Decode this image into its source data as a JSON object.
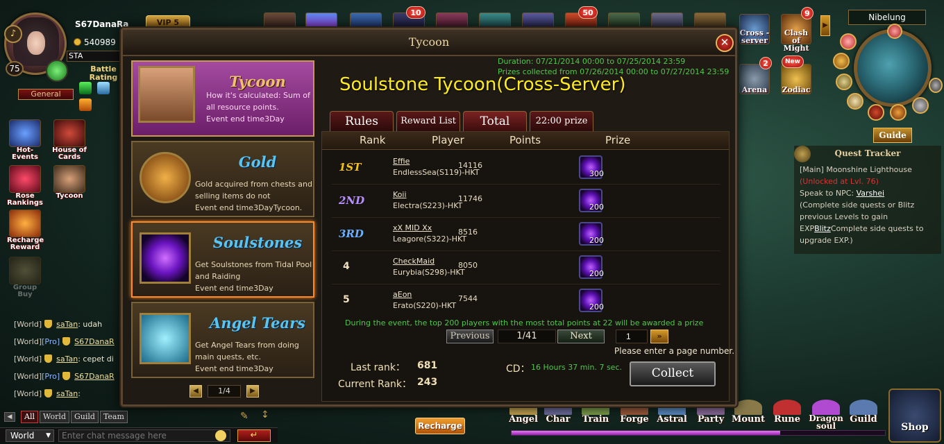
{
  "player": {
    "name": "S67DanaRa",
    "vip": "VIP 5",
    "gold": "540989",
    "sta_label": "STA",
    "level": "75",
    "battle_rating_label": "Battle Rating",
    "guild_rank": "General"
  },
  "left_shortcuts": [
    {
      "label": "Hot-Events",
      "icon": "hot-events-icon"
    },
    {
      "label": "House of Cards",
      "icon": "house-of-cards-icon"
    },
    {
      "label": "Rose Rankings",
      "icon": "rose-rankings-icon"
    },
    {
      "label": "Tycoon",
      "icon": "tycoon-icon"
    },
    {
      "label": "Recharge Reward",
      "icon": "recharge-reward-icon"
    },
    {
      "label": "Group Buy",
      "icon": "group-buy-icon"
    }
  ],
  "top_badges": {
    "badge_a": "10",
    "badge_b": "50"
  },
  "chat": {
    "lines": [
      {
        "channel": "[World]",
        "pro": "",
        "name": "saTan",
        "message": ": udah"
      },
      {
        "channel": "[World]",
        "pro": "[Pro]",
        "name": "S67DanaR",
        "message": ""
      },
      {
        "channel": "[World]",
        "pro": "",
        "name": "saTan",
        "message": ": cepet di"
      },
      {
        "channel": "[World]",
        "pro": "[Pro]",
        "name": "S67DanaR",
        "message": ""
      },
      {
        "channel": "[World]",
        "pro": "",
        "name": "saTan",
        "message": ":"
      }
    ],
    "tabs": [
      "All",
      "World",
      "Guild",
      "Team"
    ],
    "channel": "World",
    "input_placeholder": "Enter chat message here"
  },
  "right_panel": {
    "map_name": "Nibelung",
    "guide_label": "Guide",
    "buttons": [
      {
        "label": "Cross -server",
        "badge": ""
      },
      {
        "label": "Clash of Might",
        "badge": "9"
      },
      {
        "label": "Arena",
        "badge": "2"
      },
      {
        "label": "Zodiac",
        "badge": "New"
      }
    ]
  },
  "quest_tracker": {
    "title": "Quest Tracker",
    "main_prefix": "[Main] ",
    "quest_name": "Moonshine Lighthouse",
    "unlock": "(Unlocked at Lvl. 76)",
    "speak_prefix": "Speak to NPC: ",
    "npc": "Varshei",
    "desc_a": "(Complete side quests or Blitz previous Levels to gain EXP",
    "blitz": "Blitz",
    "desc_b": "Complete side quests to upgrade EXP.)"
  },
  "bottom_menu": [
    "Angel",
    "Char",
    "Train",
    "Forge",
    "Astral",
    "Party",
    "Mount",
    "Rune",
    "Dragon soul",
    "Guild"
  ],
  "shop_label": "Shop",
  "recharge_label": "Recharge",
  "exp_progress": 0.72,
  "dialog": {
    "title": "Tycoon",
    "categories": [
      {
        "title": "Tycoon",
        "desc": "How it's calculated: Sum of all resource points.",
        "event": "Event end time3Day"
      },
      {
        "title": "Gold",
        "desc": "Gold acquired from chests and selling items do not",
        "event": "Event end time3DayTycoon."
      },
      {
        "title": "Soulstones",
        "desc": "Get Soulstones from Tidal Pool and Raiding",
        "event": "Event end time3Day"
      },
      {
        "title": "Angel Tears",
        "desc": "Get Angel Tears from doing main quests, etc.",
        "event": "Event end time3Day"
      }
    ],
    "category_page": "1/4",
    "duration": "Duration: 07/21/2014 00:00 to 07/25/2014 23:59",
    "prizes_collected": "Prizes collected from 07/26/2014 00:00 to 07/27/2014 23:59",
    "heading": "Soulstone Tycoon(Cross-Server)",
    "tabs": [
      "Rules",
      "Reward List",
      "Total",
      "22:00 prize"
    ],
    "columns": [
      "Rank",
      "Player",
      "Points",
      "Prize"
    ],
    "rows": [
      {
        "rank": "1ST",
        "name": "Effie",
        "server": "EndlessSea(S119)-HKT",
        "points": "14116",
        "prize": "300"
      },
      {
        "rank": "2ND",
        "name": "Koii",
        "server": "Electra(S223)-HKT",
        "points": "11746",
        "prize": "200"
      },
      {
        "rank": "3RD",
        "name": "xX MID Xx",
        "server": "Leagore(S322)-HKT",
        "points": "8516",
        "prize": "200"
      },
      {
        "rank": "4",
        "name": "CheckMaid",
        "server": "Eurybia(S298)-HKT",
        "points": "8050",
        "prize": "200"
      },
      {
        "rank": "5",
        "name": "aEon",
        "server": "Erato(S220)-HKT",
        "points": "7544",
        "prize": "200"
      }
    ],
    "rank_colors": {
      "first": "#f5c21a",
      "second": "#b890ff",
      "third": "#6ab0ff"
    },
    "prize_note": "During the event, the top 200 players with the most total points at 22 will be awarded a prize",
    "prev_label": "Previous",
    "page": "1/41",
    "next_label": "Next",
    "page_input": "1",
    "page_hint": "Please enter a page number.",
    "last_rank_label": "Last rank：",
    "last_rank": "681",
    "current_rank_label": "Current Rank：",
    "current_rank": "243",
    "cd_label": "CD：",
    "cd_value": "16 Hours 37 min. 7 sec.",
    "collect_label": "Collect"
  }
}
